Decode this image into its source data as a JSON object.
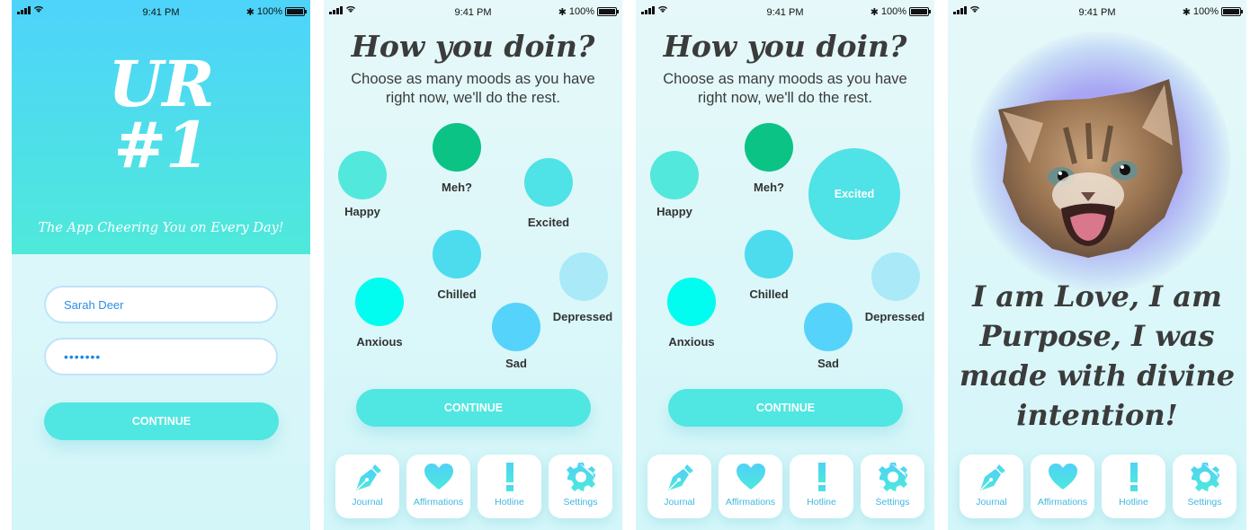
{
  "status_bar": {
    "time": "9:41 PM",
    "battery": "100%",
    "bluetooth_icon": "bluetooth-icon"
  },
  "login": {
    "logo_line1": "UR",
    "logo_line2": "#1",
    "tagline": "The App Cheering You on Every Day!",
    "username_value": "Sarah Deer",
    "password_value": "•••••••",
    "continue_label": "CONTINUE"
  },
  "mood_screen": {
    "title": "How you doin?",
    "subtitle_line1": "Choose as many moods as you have",
    "subtitle_line2": "right now, we'll do the rest.",
    "continue_label": "CONTINUE",
    "moods": [
      {
        "label": "Happy",
        "color": "#52e8dc"
      },
      {
        "label": "Meh?",
        "color": "#0bc384"
      },
      {
        "label": "Excited",
        "color": "#4fe2e6"
      },
      {
        "label": "Chilled",
        "color": "#4cdcee"
      },
      {
        "label": "Depressed",
        "color": "#a9e9f8"
      },
      {
        "label": "Anxious",
        "color": "#00fdf0"
      },
      {
        "label": "Sad",
        "color": "#55d3fb"
      }
    ],
    "selected_mood_screen3": "Excited"
  },
  "affirmation": {
    "image": "kitten-face",
    "line1": "I am Love, I am",
    "line2": "Purpose, I was",
    "line3": "made with divine",
    "line4": "intention!"
  },
  "nav": [
    {
      "label": "Journal",
      "icon": "pen-nib-icon"
    },
    {
      "label": "Affirmations",
      "icon": "heart-icon"
    },
    {
      "label": "Hotline",
      "icon": "exclamation-icon"
    },
    {
      "label": "Settings",
      "icon": "gear-icon"
    }
  ],
  "colors": {
    "accent": "#50e6e1",
    "nav_text": "#3fb8e0",
    "heading": "#3b3b3b"
  }
}
